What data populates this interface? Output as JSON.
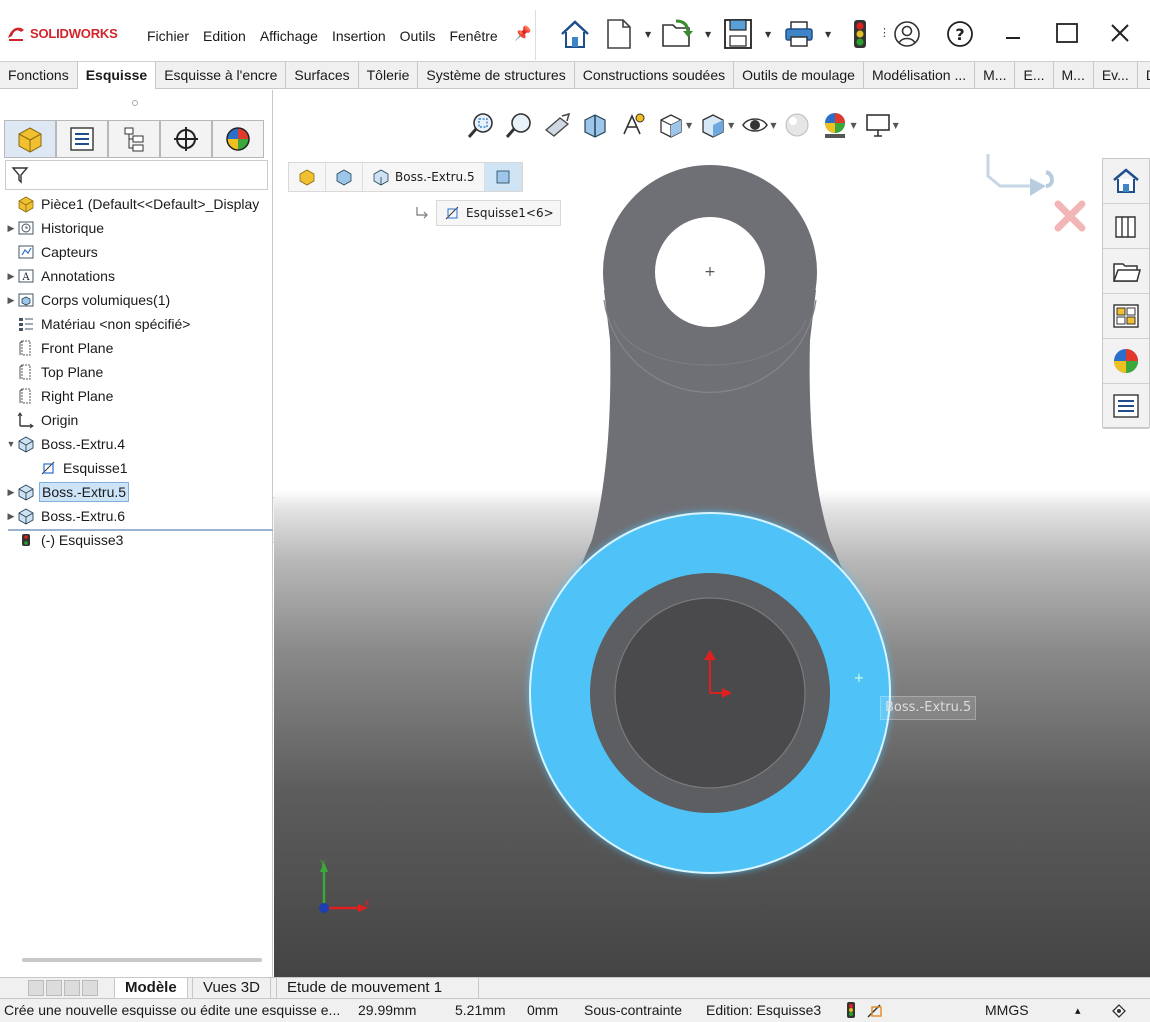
{
  "app": {
    "brand_ds": "3S",
    "brand": "SOLIDWORKS"
  },
  "menu": [
    "Fichier",
    "Edition",
    "Affichage",
    "Insertion",
    "Outils",
    "Fenêtre"
  ],
  "toolbar_icons": [
    "home-icon",
    "new-document-icon",
    "open-icon",
    "save-icon",
    "print-icon",
    "traffic-light-icon",
    "user-icon",
    "help-icon"
  ],
  "window_controls": [
    "minimize-icon",
    "maximize-icon",
    "close-icon"
  ],
  "command_tabs": [
    {
      "label": "Fonctions",
      "active": false
    },
    {
      "label": "Esquisse",
      "active": true
    },
    {
      "label": "Esquisse à l'encre",
      "active": false
    },
    {
      "label": "Surfaces",
      "active": false
    },
    {
      "label": "Tôlerie",
      "active": false
    },
    {
      "label": "Système de structures",
      "active": false
    },
    {
      "label": "Constructions soudées",
      "active": false
    },
    {
      "label": "Outils de moulage",
      "active": false
    },
    {
      "label": "Modélisation ...",
      "active": false
    },
    {
      "label": "M...",
      "active": false
    },
    {
      "label": "E...",
      "active": false
    },
    {
      "label": "M...",
      "active": false
    },
    {
      "label": "Ev...",
      "active": false
    },
    {
      "label": "Di...",
      "active": false
    }
  ],
  "panel_tabs": [
    "featuremanager-icon",
    "propertymanager-icon",
    "configurationmanager-icon",
    "dimxpert-icon",
    "display-manager-icon"
  ],
  "tree": {
    "root": "Pièce1  (Default<<Default>_Display",
    "items": [
      {
        "label": "Historique",
        "expand": "collapsed",
        "indent": 0,
        "icon": "history-icon"
      },
      {
        "label": "Capteurs",
        "expand": "none",
        "indent": 0,
        "icon": "sensor-icon"
      },
      {
        "label": "Annotations",
        "expand": "collapsed",
        "indent": 0,
        "icon": "annotation-icon"
      },
      {
        "label": "Corps volumiques(1)",
        "expand": "collapsed",
        "indent": 0,
        "icon": "solid-bodies-icon"
      },
      {
        "label": "Matériau <non spécifié>",
        "expand": "none",
        "indent": 0,
        "icon": "material-icon"
      },
      {
        "label": "Front Plane",
        "expand": "none",
        "indent": 0,
        "icon": "plane-icon"
      },
      {
        "label": "Top Plane",
        "expand": "none",
        "indent": 0,
        "icon": "plane-icon"
      },
      {
        "label": "Right Plane",
        "expand": "none",
        "indent": 0,
        "icon": "plane-icon"
      },
      {
        "label": "Origin",
        "expand": "none",
        "indent": 0,
        "icon": "origin-icon"
      },
      {
        "label": "Boss.-Extru.4",
        "expand": "expanded",
        "indent": 0,
        "icon": "extrude-icon"
      },
      {
        "label": "Esquisse1",
        "expand": "none",
        "indent": 1,
        "icon": "sketch-icon"
      },
      {
        "label": "Boss.-Extru.5",
        "expand": "collapsed",
        "indent": 0,
        "icon": "extrude-icon",
        "selected": true
      },
      {
        "label": "Boss.-Extru.6",
        "expand": "collapsed",
        "indent": 0,
        "icon": "extrude-icon"
      },
      {
        "label": "(-) Esquisse3",
        "expand": "none",
        "indent": 0,
        "icon": "sketch-edit-icon"
      }
    ]
  },
  "breadcrumb": {
    "items": [
      "part-icon",
      "body-icon",
      "Boss.-Extru.5",
      "face-icon"
    ],
    "sub": "Esquisse1<6>"
  },
  "viewport": {
    "tooltip": "Boss.-Extru.5",
    "accent": "#4fc3f7",
    "part_color": "#6f7075"
  },
  "bottom_tabs": [
    {
      "label": "Modèle",
      "active": true
    },
    {
      "label": "Vues 3D",
      "active": false
    },
    {
      "label": "Etude de mouvement 1",
      "active": false
    }
  ],
  "status": {
    "message": "Crée une nouvelle esquisse ou édite une esquisse e...",
    "x": "29.99mm",
    "y": "5.21mm",
    "z": "0mm",
    "state": "Sous-contrainte",
    "editing": "Edition: Esquisse3",
    "units": "MMGS",
    "caret": "▴"
  }
}
